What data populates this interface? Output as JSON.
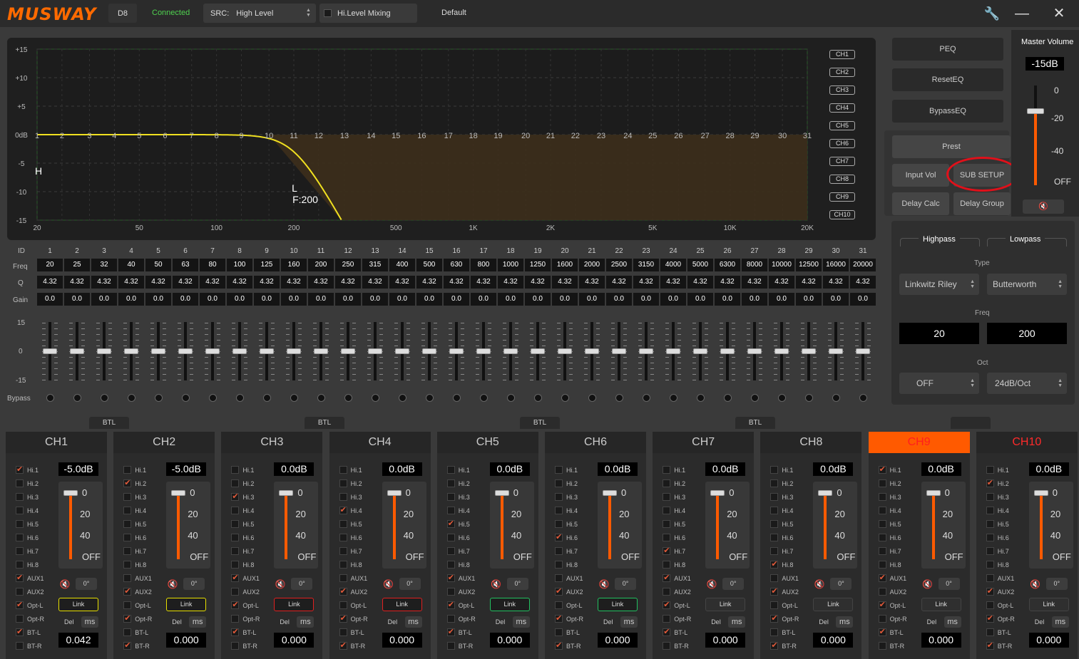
{
  "app": {
    "brand": "MUSWAY",
    "device": "D8",
    "status": "Connected",
    "src_label": "SRC:",
    "src_value": "High Level",
    "mixing_label": "Hi.Level Mixing",
    "preset_name": "Default"
  },
  "eq_graph": {
    "y_labels": [
      "+15",
      "+10",
      "+5",
      "0dB",
      "-5",
      "-10",
      "-15"
    ],
    "x_labels": [
      "20",
      "50",
      "100",
      "200",
      "500",
      "1K",
      "2K",
      "5K",
      "10K",
      "20K"
    ],
    "band_numbers": [
      "1",
      "2",
      "3",
      "4",
      "5",
      "6",
      "7",
      "8",
      "9",
      "10",
      "11",
      "12",
      "13",
      "14",
      "15",
      "16",
      "17",
      "18",
      "19",
      "20",
      "21",
      "22",
      "23",
      "24",
      "25",
      "26",
      "27",
      "28",
      "29",
      "30",
      "31"
    ],
    "hp_marker": "H",
    "lp_marker": "L",
    "lp_freq_label": "F:200",
    "curve_color": "#f0e020",
    "channel_buttons": [
      "CH1",
      "CH2",
      "CH3",
      "CH4",
      "CH5",
      "CH6",
      "CH7",
      "CH8",
      "CH9",
      "CH10"
    ]
  },
  "eq_table": {
    "row_labels": {
      "id": "ID",
      "freq": "Freq",
      "q": "Q",
      "gain": "Gain",
      "bypass": "Bypass"
    },
    "ids": [
      "1",
      "2",
      "3",
      "4",
      "5",
      "6",
      "7",
      "8",
      "9",
      "10",
      "11",
      "12",
      "13",
      "14",
      "15",
      "16",
      "17",
      "18",
      "19",
      "20",
      "21",
      "22",
      "23",
      "24",
      "25",
      "26",
      "27",
      "28",
      "29",
      "30",
      "31"
    ],
    "freqs": [
      "20",
      "25",
      "32",
      "40",
      "50",
      "63",
      "80",
      "100",
      "125",
      "160",
      "200",
      "250",
      "315",
      "400",
      "500",
      "630",
      "800",
      "1000",
      "1250",
      "1600",
      "2000",
      "2500",
      "3150",
      "4000",
      "5000",
      "6300",
      "8000",
      "10000",
      "12500",
      "16000",
      "20000"
    ],
    "q_value": "4.32",
    "gain_value": "0.0",
    "slider_scale": [
      "15",
      "0",
      "-15"
    ]
  },
  "right_panel": {
    "peq": "PEQ",
    "reset_eq": "ResetEQ",
    "bypass_eq": "BypassEQ",
    "preset": "Prest",
    "input_vol": "Input Vol",
    "sub_setup": "SUB SETUP",
    "delay_calc": "Delay Calc",
    "delay_group": "Delay Group",
    "master_volume_label": "Master Volume",
    "master_volume_value": "-15dB",
    "master_scale": [
      "0",
      "-20",
      "-40",
      "OFF"
    ]
  },
  "crossover": {
    "highpass_label": "Highpass",
    "lowpass_label": "Lowpass",
    "type_label": "Type",
    "hp_type": "Linkwitz Riley",
    "lp_type": "Butterworth",
    "freq_label": "Freq",
    "hp_freq": "20",
    "lp_freq": "200",
    "oct_label": "Oct",
    "hp_oct": "OFF",
    "lp_oct": "24dB/Oct"
  },
  "btl_label": "BTL",
  "input_names": [
    "Hi.1",
    "Hi.2",
    "Hi.3",
    "Hi.4",
    "Hi.5",
    "Hi.6",
    "Hi.7",
    "Hi.8",
    "AUX1",
    "AUX2",
    "Opt-L",
    "Opt-R",
    "BT-L",
    "BT-R"
  ],
  "strip_common": {
    "vol_scale": [
      "0",
      "20",
      "40",
      "OFF"
    ],
    "phase": "0°",
    "link": "Link",
    "del": "Del",
    "ms": "ms"
  },
  "channels": [
    {
      "name": "CH1",
      "gain": "-5.0dB",
      "delay": "0.042",
      "checked": [
        0,
        8,
        10,
        12
      ],
      "link_style": "yellow",
      "header": "normal"
    },
    {
      "name": "CH2",
      "gain": "-5.0dB",
      "delay": "0.000",
      "checked": [
        1,
        9,
        11,
        13
      ],
      "link_style": "yellow",
      "header": "normal"
    },
    {
      "name": "CH3",
      "gain": "0.0dB",
      "delay": "0.000",
      "checked": [
        2,
        8,
        10,
        12
      ],
      "link_style": "redb",
      "header": "normal"
    },
    {
      "name": "CH4",
      "gain": "0.0dB",
      "delay": "0.000",
      "checked": [
        3,
        9,
        11,
        13
      ],
      "link_style": "redb",
      "header": "normal"
    },
    {
      "name": "CH5",
      "gain": "0.0dB",
      "delay": "0.000",
      "checked": [
        4,
        8,
        10,
        12
      ],
      "link_style": "greenb",
      "header": "normal"
    },
    {
      "name": "CH6",
      "gain": "0.0dB",
      "delay": "0.000",
      "checked": [
        5,
        9,
        11,
        13
      ],
      "link_style": "greenb",
      "header": "normal"
    },
    {
      "name": "CH7",
      "gain": "0.0dB",
      "delay": "0.000",
      "checked": [
        6,
        8,
        10,
        12
      ],
      "link_style": "plain",
      "header": "normal"
    },
    {
      "name": "CH8",
      "gain": "0.0dB",
      "delay": "0.000",
      "checked": [
        7,
        9,
        11,
        13
      ],
      "link_style": "plain",
      "header": "normal"
    },
    {
      "name": "CH9",
      "gain": "0.0dB",
      "delay": "0.000",
      "checked": [
        0,
        8,
        10,
        12
      ],
      "link_style": "plain",
      "header": "active"
    },
    {
      "name": "CH10",
      "gain": "0.0dB",
      "delay": "0.000",
      "checked": [
        1,
        9,
        11,
        13
      ],
      "link_style": "plain",
      "header": "red"
    }
  ]
}
